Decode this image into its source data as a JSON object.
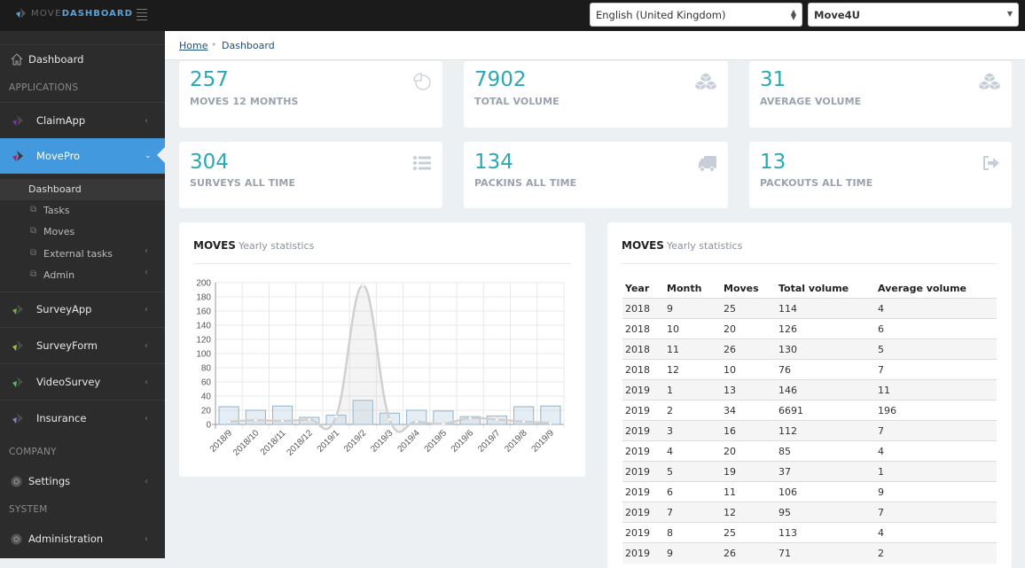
{
  "topbar": {
    "logo_part1": "MOVE",
    "logo_part2": "DASHBOARD",
    "language_select": "English (United Kingdom)",
    "company_select": "Move4U"
  },
  "sidebar": {
    "dashboard": "Dashboard",
    "section_applications": "APPLICATIONS",
    "apps": [
      {
        "label": "ClaimApp",
        "accent": "#7b2fa8"
      },
      {
        "label": "MovePro",
        "accent": "#c2185b",
        "active": true
      },
      {
        "label": "SurveyApp",
        "accent": "#6ab04c"
      },
      {
        "label": "SurveyForm",
        "accent": "#9bc53d"
      },
      {
        "label": "VideoSurvey",
        "accent": "#5cb85c"
      },
      {
        "label": "Insurance",
        "accent": "#8e7cc3"
      }
    ],
    "movepro_sub": [
      "Dashboard",
      "Tasks",
      "Moves",
      "External tasks",
      "Admin"
    ],
    "section_company": "COMPANY",
    "settings": "Settings",
    "section_system": "SYSTEM",
    "administration": "Administration"
  },
  "breadcrumb": {
    "home": "Home",
    "current": "Dashboard"
  },
  "stats": [
    {
      "value": "257",
      "label": "MOVES 12 MONTHS",
      "icon": "pie-chart-icon"
    },
    {
      "value": "7902",
      "label": "TOTAL VOLUME",
      "icon": "cubes-icon"
    },
    {
      "value": "31",
      "label": "AVERAGE VOLUME",
      "icon": "cubes-icon"
    },
    {
      "value": "304",
      "label": "SURVEYS ALL TIME",
      "icon": "list-icon"
    },
    {
      "value": "134",
      "label": "PACKINS ALL TIME",
      "icon": "truck-icon"
    },
    {
      "value": "13",
      "label": "PACKOUTS ALL TIME",
      "icon": "sign-out-icon"
    }
  ],
  "chart_panel": {
    "title": "MOVES",
    "subtitle": "Yearly statistics"
  },
  "table_panel": {
    "title": "MOVES",
    "subtitle": "Yearly statistics"
  },
  "table": {
    "headers": [
      "Year",
      "Month",
      "Moves",
      "Total volume",
      "Average volume"
    ],
    "rows": [
      [
        "2018",
        "9",
        "25",
        "114",
        "4"
      ],
      [
        "2018",
        "10",
        "20",
        "126",
        "6"
      ],
      [
        "2018",
        "11",
        "26",
        "130",
        "5"
      ],
      [
        "2018",
        "12",
        "10",
        "76",
        "7"
      ],
      [
        "2019",
        "1",
        "13",
        "146",
        "11"
      ],
      [
        "2019",
        "2",
        "34",
        "6691",
        "196"
      ],
      [
        "2019",
        "3",
        "16",
        "112",
        "7"
      ],
      [
        "2019",
        "4",
        "20",
        "85",
        "4"
      ],
      [
        "2019",
        "5",
        "19",
        "37",
        "1"
      ],
      [
        "2019",
        "6",
        "11",
        "106",
        "9"
      ],
      [
        "2019",
        "7",
        "12",
        "95",
        "7"
      ],
      [
        "2019",
        "8",
        "25",
        "113",
        "4"
      ],
      [
        "2019",
        "9",
        "26",
        "71",
        "2"
      ]
    ]
  },
  "chart_data": {
    "type": "bar",
    "title": "MOVES Yearly statistics",
    "xlabel": "",
    "ylabel": "",
    "categories": [
      "2018/9",
      "2018/10",
      "2018/11",
      "2018/12",
      "2019/1",
      "2019/2",
      "2019/3",
      "2019/4",
      "2019/5",
      "2019/6",
      "2019/7",
      "2019/8",
      "2019/9"
    ],
    "series": [
      {
        "name": "Moves",
        "type": "bar",
        "values": [
          25,
          20,
          26,
          10,
          13,
          34,
          16,
          20,
          19,
          11,
          12,
          25,
          26
        ]
      },
      {
        "name": "Average volume",
        "type": "line",
        "values": [
          4,
          6,
          5,
          7,
          11,
          196,
          7,
          4,
          1,
          9,
          7,
          4,
          2
        ]
      }
    ],
    "ylim": [
      0,
      200
    ],
    "yticks": [
      0,
      20,
      40,
      60,
      80,
      100,
      120,
      140,
      160,
      180,
      200
    ],
    "grid": true,
    "legend": "none"
  }
}
